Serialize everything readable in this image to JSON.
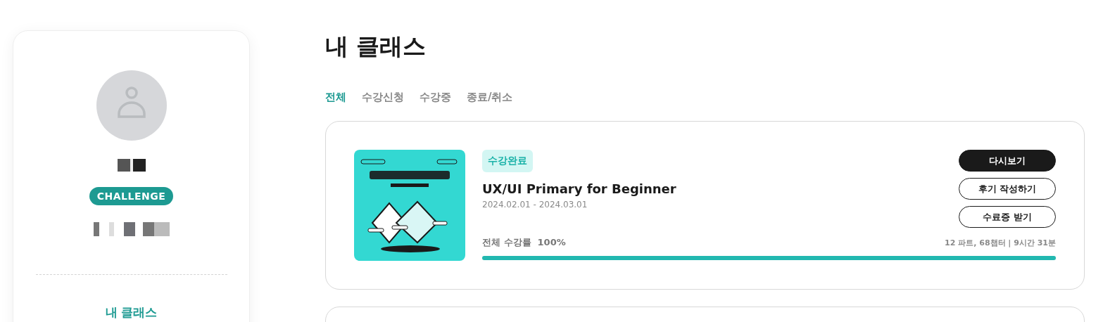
{
  "sidebar": {
    "badge": "CHALLENGE",
    "menu": [
      {
        "label": "내 클래스",
        "selected": true
      }
    ]
  },
  "page_title": "내 클래스",
  "tabs": [
    {
      "label": "전체",
      "selected": true
    },
    {
      "label": "수강신청",
      "selected": false
    },
    {
      "label": "수강중",
      "selected": false
    },
    {
      "label": "종료/취소",
      "selected": false
    }
  ],
  "courses": [
    {
      "status": "수강완료",
      "title": "UX/UI Primary for Beginner",
      "period": "2024.02.01 - 2024.03.01",
      "progress_label": "전체 수강률  100%",
      "level": 1,
      "meta": "12 파트, 68챕터 | 9시간 31분",
      "buttons": [
        {
          "label": "다시보기",
          "kind": "primary"
        },
        {
          "label": "후기 작성하기",
          "kind": "outline"
        },
        {
          "label": "수료증 받기",
          "kind": "outline"
        }
      ]
    }
  ]
}
